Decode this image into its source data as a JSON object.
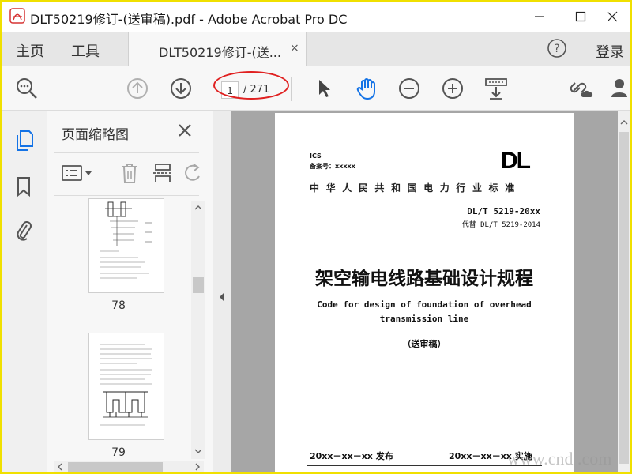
{
  "window": {
    "title": "DLT50219修订-(送审稿).pdf - Adobe Acrobat Pro DC",
    "minimize": "—",
    "maximize": "☐",
    "close": "✕"
  },
  "tabs": {
    "home": "主页",
    "tools": "工具",
    "document": "DLT50219修订-(送...",
    "document_close": "×",
    "login": "登录"
  },
  "toolbar": {
    "current_page": "1",
    "total_pages": "/ 271"
  },
  "thumbnail_panel": {
    "title": "页面缩略图",
    "pages": [
      {
        "label": "78"
      },
      {
        "label": "79"
      }
    ]
  },
  "document": {
    "ics": "ICS",
    "record_no": "备案号：xxxxx",
    "logo": "DL",
    "industry_standard": "中华人民共和国电力行业标准",
    "standard_no": "DL/T 5219-20xx",
    "replaces": "代替 DL/T 5219-2014",
    "title_cn": "架空输电线路基础设计规程",
    "title_en_line1": "Code for design of foundation of overhead",
    "title_en_line2": "transmission line",
    "draft": "（送审稿）",
    "publish": "20xx－xx－xx 发布",
    "implement": "20xx－xx－xx 实施"
  },
  "watermark": "www.cnd   .com",
  "colors": {
    "frame": "#f0e000",
    "annotation_ellipse": "#e02020",
    "accent_blue": "#1473e6"
  }
}
